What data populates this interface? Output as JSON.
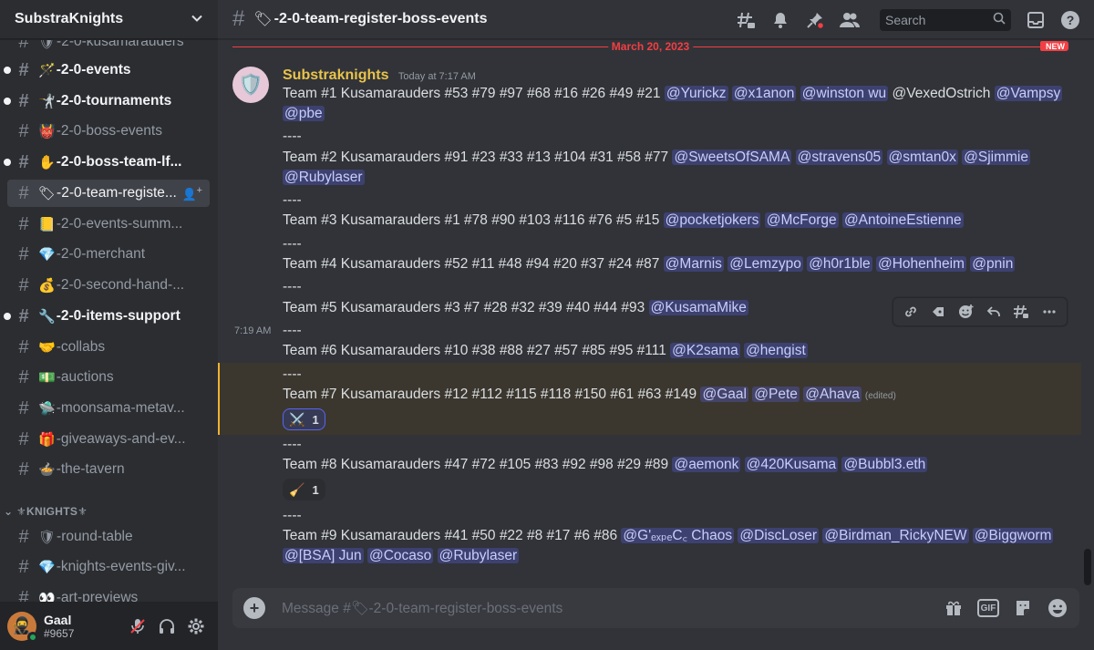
{
  "server": {
    "name": "SubstraKnights"
  },
  "channels": [
    {
      "emoji": "🛡",
      "label": "-2-0-kusamarauders",
      "unread": false
    },
    {
      "emoji": "🪄",
      "label": "-2-0-events",
      "unread": true
    },
    {
      "emoji": "🤺",
      "label": "-2-0-tournaments",
      "unread": true
    },
    {
      "emoji": "👹",
      "label": "-2-0-boss-events",
      "unread": false
    },
    {
      "emoji": "✋",
      "label": "-2-0-boss-team-lf...",
      "unread": true
    },
    {
      "emoji": "🏷",
      "label": "-2-0-team-registe...",
      "unread": false,
      "active": true
    },
    {
      "emoji": "📒",
      "label": "-2-0-events-summ...",
      "unread": false
    },
    {
      "emoji": "💎",
      "label": "-2-0-merchant",
      "unread": false
    },
    {
      "emoji": "💰",
      "label": "-2-0-second-hand-...",
      "unread": false
    },
    {
      "emoji": "🔧",
      "label": "-2-0-items-support",
      "unread": true
    },
    {
      "emoji": "🤝",
      "label": "-collabs",
      "unread": false
    },
    {
      "emoji": "💵",
      "label": "-auctions",
      "unread": false
    },
    {
      "emoji": "🛸",
      "label": "-moonsama-metav...",
      "unread": false
    },
    {
      "emoji": "🎁",
      "label": "-giveaways-and-ev...",
      "unread": false
    },
    {
      "emoji": "🍲",
      "label": "-the-tavern",
      "unread": false
    }
  ],
  "category": "⚜KNIGHTS⚜",
  "knight_channels": [
    {
      "emoji": "🛡",
      "label": "-round-table"
    },
    {
      "emoji": "💎",
      "label": "-knights-events-giv..."
    },
    {
      "emoji": "👀",
      "label": "-art-previews"
    }
  ],
  "user": {
    "name": "Gaal",
    "discriminator": "#9657"
  },
  "topbar": {
    "emoji": "🏷",
    "title": "-2-0-team-register-boss-events",
    "search_placeholder": "Search"
  },
  "divider": {
    "date": "March 20, 2023",
    "new_label": "NEW"
  },
  "message": {
    "author": "Substraknights",
    "timestamp": "Today at 7:17 AM",
    "side_time": "7:19 AM",
    "separator": "----",
    "lines": [
      {
        "text": "Team #1 Kusamarauders #53 #79 #97 #68 #16 #26 #49 #21 ",
        "mentions": [
          "@Yurickz",
          "@x1anon",
          "@winston wu"
        ],
        "plain_after": " @VexedOstrich ",
        "mentions2": [
          "@Vampsy"
        ]
      },
      {
        "mentions": [
          "@pbe"
        ]
      }
    ],
    "teams": [
      {
        "text": "Team #2 Kusamarauders #91 #23 #33 #13 #104 #31 #58 #77 ",
        "mentions": [
          "@SweetsOfSAMA",
          "@stravens05",
          "@smtan0x",
          "@Sjimmie"
        ],
        "mentions_line2": [
          "@Rubylaser"
        ]
      },
      {
        "text": "Team #3 Kusamarauders #1 #78 #90 #103 #116 #76 #5 #15 ",
        "mentions": [
          "@pocketjokers",
          "@McForge",
          "@AntoineEstienne"
        ]
      },
      {
        "text": "Team #4 Kusamarauders #52 #11 #48 #94 #20 #37 #24 #87 ",
        "mentions": [
          "@Marnis",
          "@Lemzypo",
          "@h0r1ble",
          "@Hohenheim",
          "@pnin"
        ]
      },
      {
        "text": "Team #5 Kusamarauders #3 #7 #28 #32 #39 #40 #44 #93 ",
        "mentions": [
          "@KusamaMike"
        ]
      },
      {
        "text": "Team #6 Kusamarauders #10 #38 #88 #27 #57 #85 #95 #111 ",
        "mentions": [
          "@K2sama",
          "@hengist"
        ]
      },
      {
        "text": "Team #7 Kusamarauders #12 #112 #115 #118 #150 #61 #63 #149 ",
        "mentions": [
          "@Gaal",
          "@Pete",
          "@Ahava"
        ],
        "edited": "(edited)"
      },
      {
        "text": "Team #8 Kusamarauders #47 #72 #105 #83 #92 #98 #29 #89 ",
        "mentions": [
          "@aemonk",
          "@420Kusama",
          "@Bubbl3.eth"
        ]
      },
      {
        "text": "Team #9 Kusamarauders #41 #50 #22 #8 #17 #6 #86 ",
        "mentions": [
          "@G'ₑₓₚₑC꜀ Chaos",
          "@DiscLoser",
          "@Birdman_RickyNEW",
          "@Biggworm"
        ],
        "mentions_line2": [
          "@[BSA] Jun",
          "@Cocaso",
          "@Rubylaser"
        ]
      }
    ],
    "reactions": [
      {
        "emoji": "⚔️",
        "count": "1"
      },
      {
        "emoji": "🧹",
        "count": "1"
      }
    ]
  },
  "composer": {
    "placeholder": "Message #🏷-2-0-team-register-boss-events",
    "gif_label": "GIF"
  },
  "colors": {
    "accent": "#5865f2",
    "author": "#e9c34b",
    "new_divider": "#f23f43",
    "highlight": "#f0b232"
  }
}
